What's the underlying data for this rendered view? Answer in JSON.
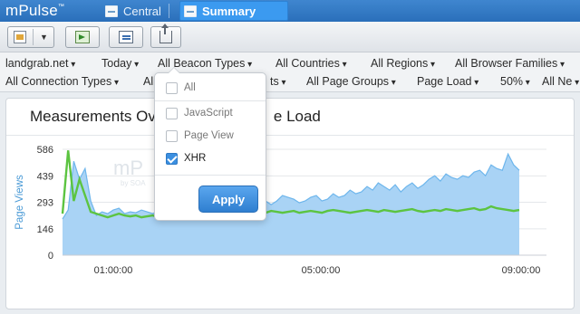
{
  "app": {
    "brand": "mPulse",
    "trademark": "™"
  },
  "tabs": [
    {
      "label": "Central",
      "active": false
    },
    {
      "label": "Summary",
      "active": true
    }
  ],
  "toolbar": {
    "buttons": [
      {
        "name": "dashboard-menu",
        "icon": "dashboard-icon",
        "has_caret": true
      },
      {
        "name": "export",
        "icon": "export-arrow-icon"
      },
      {
        "name": "edit",
        "icon": "edit-icon"
      },
      {
        "name": "share",
        "icon": "share-icon"
      }
    ]
  },
  "filters": {
    "row1": [
      "landgrab.net",
      "Today",
      "All Beacon Types",
      "All Countries",
      "All Regions",
      "All Browser Families"
    ],
    "row2": [
      "All Connection Types",
      "All",
      "ts",
      "All Page Groups",
      "Page Load",
      "50%",
      "All Ne"
    ]
  },
  "panel": {
    "title": "Measurements Ov",
    "title_tail": "e Load"
  },
  "popover": {
    "options": [
      {
        "label": "All",
        "checked": false
      },
      {
        "label": "JavaScript",
        "checked": false
      },
      {
        "label": "Page View",
        "checked": false
      },
      {
        "label": "XHR",
        "checked": true
      }
    ],
    "apply_label": "Apply"
  },
  "watermark": {
    "text": "mP",
    "sub": "by SOA"
  },
  "chart_data": {
    "type": "area",
    "ylabel": "Page Views",
    "xlabel": "",
    "yticks": [
      0,
      146,
      293,
      439,
      586
    ],
    "ylim": [
      0,
      586
    ],
    "xticks": [
      "01:00:00",
      "05:00:00",
      "09:00:00"
    ],
    "grid": true,
    "series": [
      {
        "color": "#6eb6ec",
        "fill": "#a9d3f5",
        "type": "area",
        "values": [
          200,
          250,
          520,
          420,
          480,
          300,
          220,
          240,
          230,
          250,
          260,
          230,
          240,
          235,
          250,
          240,
          230,
          245,
          260,
          270,
          330,
          290,
          340,
          300,
          360,
          330,
          380,
          350,
          320,
          300,
          330,
          300,
          310,
          290,
          320,
          310,
          300,
          280,
          300,
          330,
          320,
          310,
          290,
          300,
          320,
          330,
          300,
          310,
          340,
          320,
          330,
          360,
          340,
          350,
          380,
          360,
          400,
          380,
          360,
          390,
          350,
          380,
          400,
          370,
          390,
          420,
          440,
          410,
          450,
          430,
          420,
          440,
          430,
          460,
          470,
          440,
          500,
          480,
          470,
          560,
          500,
          470
        ]
      },
      {
        "color": "#5cc441",
        "type": "line",
        "values": [
          230,
          580,
          300,
          420,
          330,
          240,
          230,
          220,
          210,
          220,
          230,
          220,
          215,
          220,
          210,
          215,
          220,
          210,
          205,
          200,
          210,
          215,
          220,
          225,
          215,
          220,
          410,
          230,
          240,
          235,
          240,
          235,
          245,
          240,
          230,
          240,
          235,
          245,
          240,
          235,
          240,
          245,
          235,
          240,
          245,
          240,
          235,
          245,
          250,
          245,
          240,
          235,
          240,
          245,
          250,
          245,
          240,
          250,
          245,
          240,
          245,
          250,
          255,
          245,
          240,
          245,
          250,
          245,
          255,
          250,
          245,
          250,
          255,
          260,
          250,
          255,
          270,
          260,
          255,
          250,
          245,
          250
        ]
      }
    ]
  }
}
